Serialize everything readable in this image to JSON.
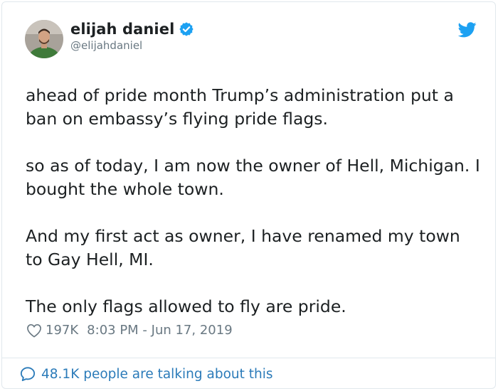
{
  "author": {
    "display_name": "elijah daniel",
    "handle": "@elijahdaniel",
    "verified": true
  },
  "tweet": {
    "paragraphs": [
      "ahead of pride month Trump’s administration put a ban on embassy’s flying pride flags.",
      "so as of today, I am now the owner of Hell, Michigan. I bought the whole town.",
      "And my first act as owner, I have renamed my town to Gay Hell, MI.",
      "The only flags allowed to fly are pride."
    ],
    "likes": "197K",
    "timestamp": "8:03 PM - Jun 17, 2019"
  },
  "footer": {
    "talking_label": "48.1K people are talking about this"
  },
  "icons": {
    "brand": "twitter-bird-icon",
    "verified": "verified-badge-icon",
    "like": "heart-icon",
    "reply": "speech-bubble-icon"
  },
  "colors": {
    "twitter_blue": "#1da1f2",
    "link_blue": "#2b7bb9",
    "meta_gray": "#697882",
    "text": "#1c2022"
  }
}
